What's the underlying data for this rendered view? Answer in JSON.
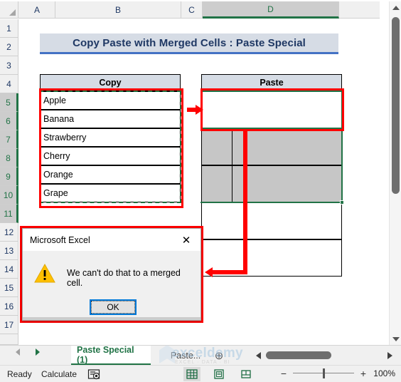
{
  "grid": {
    "columns": [
      "A",
      "B",
      "C",
      "D"
    ],
    "selected_column": "D",
    "rows": [
      "1",
      "2",
      "3",
      "4",
      "5",
      "6",
      "7",
      "8",
      "9",
      "10",
      "11",
      "12",
      "13",
      "14",
      "15",
      "16",
      "17"
    ],
    "selected_rows": [
      "5",
      "6",
      "7",
      "8",
      "9",
      "10",
      "11"
    ]
  },
  "sheet": {
    "title_banner": "Copy Paste with Merged Cells : Paste Special",
    "copy_header": "Copy",
    "paste_header": "Paste",
    "copy_values": [
      "Apple",
      "Banana",
      "Strawberry",
      "Cherry",
      "Orange",
      "Grape"
    ],
    "paste_values": [
      "",
      "",
      "",
      "",
      "",
      ""
    ]
  },
  "dialog": {
    "title": "Microsoft Excel",
    "close_label": "✕",
    "message": "We can't do that to a merged cell.",
    "ok_label": "OK",
    "warning_icon": "warning-triangle-icon"
  },
  "tabs": {
    "nav_prev_icon": "previous-sheet-arrow-icon",
    "nav_next_icon": "next-sheet-arrow-icon",
    "items": [
      {
        "label": "Paste Special (1)",
        "active": true
      },
      {
        "label": "Paste...",
        "active": false
      }
    ],
    "add_sheet_label": "⊕"
  },
  "status": {
    "ready": "Ready",
    "calculate": "Calculate",
    "record_macro_icon": "record-macro-icon",
    "views": [
      {
        "icon": "normal-view-icon",
        "active": true
      },
      {
        "icon": "page-layout-view-icon",
        "active": false
      },
      {
        "icon": "page-break-preview-icon",
        "active": false
      }
    ],
    "zoom_out": "−",
    "zoom_in": "+",
    "zoom_level": "100%"
  },
  "watermark": {
    "text": "exceldemy",
    "subtitle": "EXCEL · DATA · BI"
  },
  "colors": {
    "excel_green": "#217346",
    "annotation_red": "#ff0000",
    "banner_fill": "#d6dce5",
    "banner_text": "#1f3864",
    "merged_gray": "#c6c6c6"
  }
}
